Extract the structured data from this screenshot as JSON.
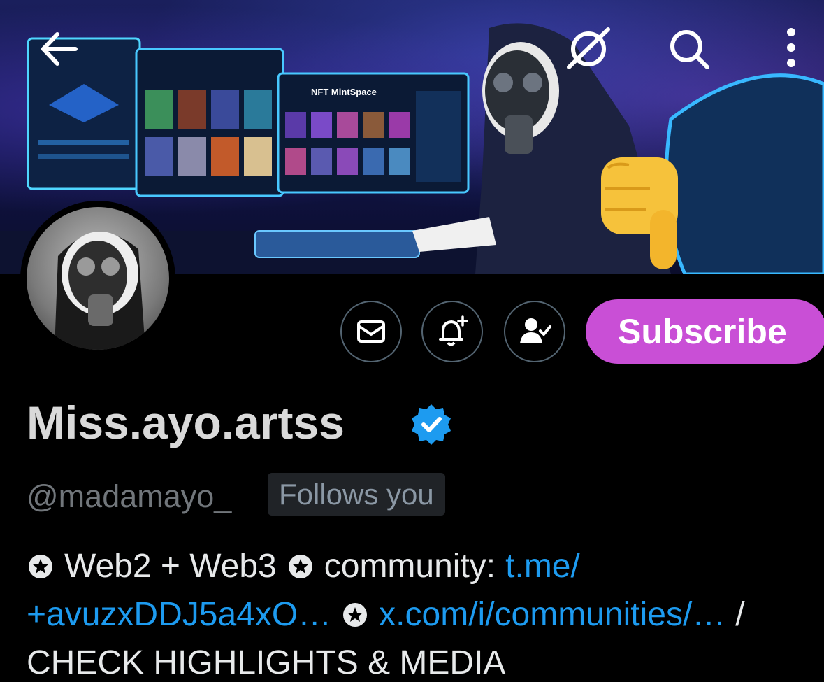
{
  "header": {
    "icons": [
      "back-arrow-icon",
      "grok-icon",
      "search-icon",
      "more-vertical-icon"
    ]
  },
  "banner": {
    "monitor_label": "NFT MintSpace",
    "sticker": "thumbs-down-emoji"
  },
  "actions": {
    "message_icon": "envelope-icon",
    "notify_icon": "bell-plus-icon",
    "following_icon": "person-check-icon",
    "subscribe_label": "Subscribe"
  },
  "profile": {
    "display_name": "Miss.ayo.artss",
    "verified": true,
    "handle": "@madamayo_",
    "follows_you": "Follows you"
  },
  "bio": {
    "line1_text1": "Web2 + Web3",
    "line1_text2": "community:",
    "line1_link": "t.me/",
    "line2_link1": "+avuzxDDJ5a4xO…",
    "line2_link2": "x.com/i/communities/…",
    "line2_slash": "/",
    "line3_text": "CHECK HIGHLIGHTS & MEDIA"
  },
  "colors": {
    "background": "#000000",
    "link": "#1d9bf0",
    "subscribe": "#c94fd6",
    "verified": "#1d9bf0"
  }
}
